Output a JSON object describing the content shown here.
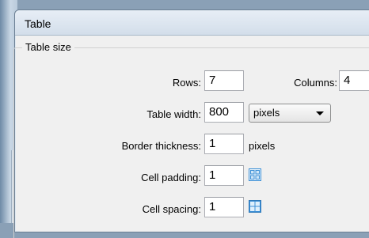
{
  "dialog": {
    "title": "Table"
  },
  "table_size": {
    "legend": "Table size",
    "rows_label": "Rows:",
    "rows_value": "7",
    "columns_label": "Columns:",
    "columns_value": "4",
    "width_label": "Table width:",
    "width_value": "800",
    "width_unit_selected": "pixels",
    "border_label": "Border thickness:",
    "border_value": "1",
    "border_unit": "pixels",
    "padding_label": "Cell padding:",
    "padding_value": "1",
    "spacing_label": "Cell spacing:",
    "spacing_value": "1"
  },
  "icons": {
    "cell_padding": "cell-padding-icon",
    "cell_spacing": "cell-spacing-icon"
  },
  "colors": {
    "icon_blue": "#3c8fd6"
  }
}
